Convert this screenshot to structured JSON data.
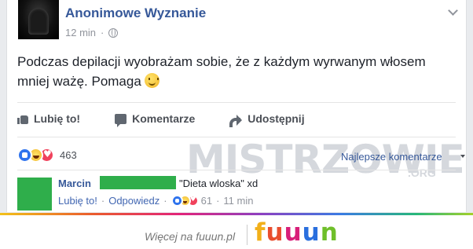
{
  "post": {
    "page_name": "Anonimowe Wyznanie",
    "time": "12 min",
    "dot": "·",
    "text": "Podczas depilacji wyobrażam sobie, że z każdym wyrwanym włosem mniej ważę. Pomaga"
  },
  "actions": {
    "like_label": "Lubię to!",
    "comment_label": "Komentarze",
    "share_label": "Udostępnij"
  },
  "reactions": {
    "count": "463",
    "types": [
      "like",
      "haha",
      "love"
    ]
  },
  "sort": {
    "label": "Najlepsze komentarze"
  },
  "watermark": {
    "text": "MISTRZOWIE",
    "sub": ".ORG"
  },
  "comment": {
    "author": "Marcin",
    "text": "\"Dieta wloska\" xd",
    "like_label": "Lubię to!",
    "reply_label": "Odpowiedz",
    "sep": "·",
    "reaction_count": "61",
    "time": "11 min"
  },
  "footer": {
    "text": "Więcej na fuuun.pl",
    "logo_letters": [
      "f",
      "u",
      "u",
      "u",
      "n"
    ],
    "logo_colors": [
      "#f2b01a",
      "#e94e2e",
      "#d81e79",
      "#2a6fde",
      "#6fbf2a"
    ]
  },
  "colors": {
    "link_blue": "#365899",
    "redaction_green": "#2fae4b",
    "background": "#e9ebee"
  }
}
